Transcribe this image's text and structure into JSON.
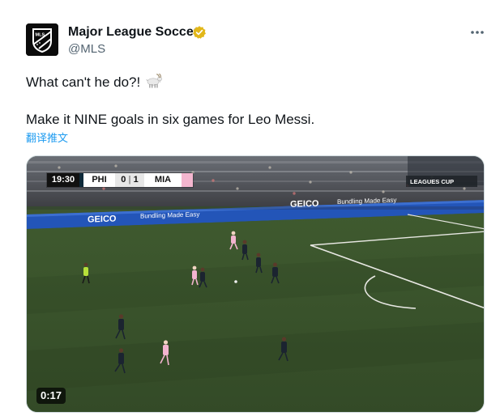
{
  "account": {
    "name": "Major League Soccer",
    "handle": "@MLS",
    "avatar_text": "MLS",
    "verified": true,
    "verified_color": "#e2b719"
  },
  "tweet": {
    "line1": "What can't he do?!",
    "line1_emoji": "goat-emoji",
    "line2": "Make it NINE goals in six games for Leo Messi.",
    "translate": "翻译推文"
  },
  "menu": {
    "more_icon": "more-horizontal-icon"
  },
  "video": {
    "duration": "0:17",
    "scorebug": {
      "clock": "19:30",
      "home": "PHI",
      "home_score": "0",
      "away_score": "1",
      "away": "MIA"
    },
    "boards": [
      "GEICO",
      "Bundling Made Easy",
      "GEICO",
      "Bundling Made Easy"
    ],
    "broadcast_logo": "LEAGUES CUP"
  },
  "colors": {
    "link": "#1d9bf0",
    "pitch": "#3d5530",
    "miami_pink": "#f4b6cf",
    "union_navy": "#1b2430"
  }
}
